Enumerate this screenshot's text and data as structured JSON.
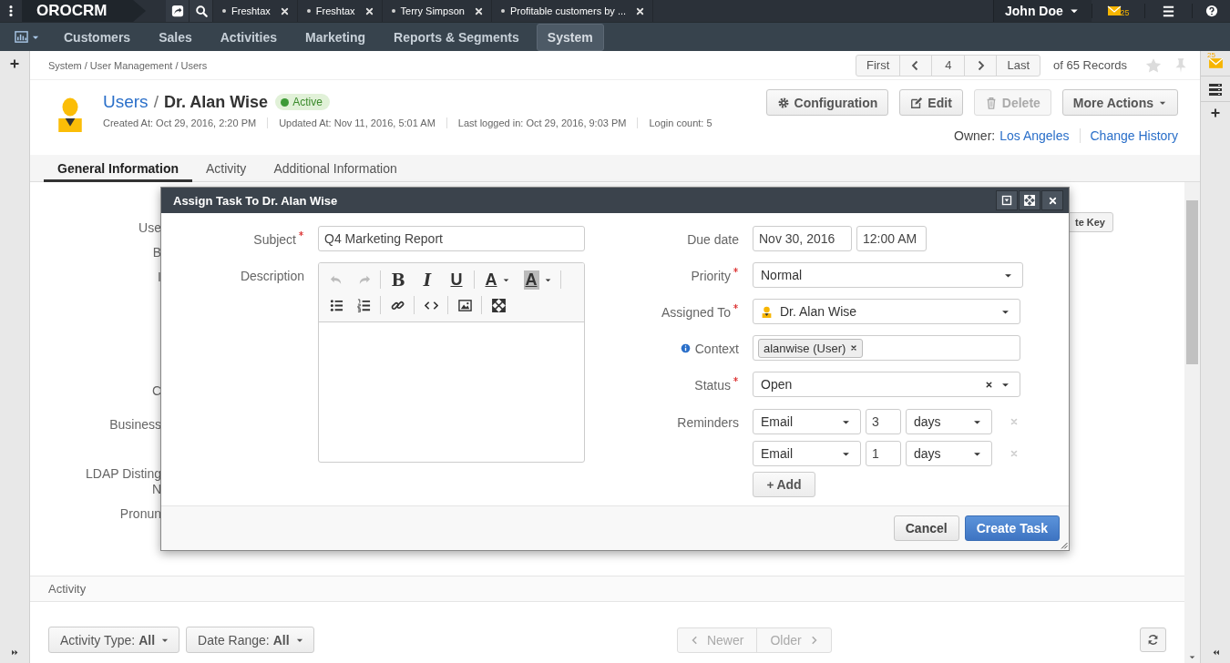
{
  "top_bar": {
    "logo": "OROCRM",
    "tabs": [
      {
        "title": "Freshtax"
      },
      {
        "title": "Freshtax"
      },
      {
        "title": "Terry Simpson"
      },
      {
        "title": "Profitable customers by ..."
      }
    ],
    "user": "John Doe",
    "mail_count": "25"
  },
  "nav": {
    "items": [
      {
        "label": "Customers",
        "selected": false
      },
      {
        "label": "Sales",
        "selected": false
      },
      {
        "label": "Activities",
        "selected": false
      },
      {
        "label": "Marketing",
        "selected": false
      },
      {
        "label": "Reports & Segments",
        "selected": false
      },
      {
        "label": "System",
        "selected": true
      }
    ]
  },
  "side_panel": {
    "mail_count": "25"
  },
  "breadcrumb": "System / User Management / Users",
  "pager": {
    "first": "First",
    "page": "4",
    "last": "Last",
    "total": "of 65 Records"
  },
  "header": {
    "section": "Users",
    "separator": "/",
    "name": "Dr. Alan Wise",
    "status": "Active",
    "meta": [
      "Created At: Oct 29, 2016, 2:20 PM",
      "Updated At: Nov 11, 2016, 5:01 AM",
      "Last logged in: Oct 29, 2016, 9:03 PM",
      "Login count: 5"
    ],
    "actions": [
      {
        "label": "Configuration",
        "kind": "configure",
        "disabled": false
      },
      {
        "label": "Edit",
        "kind": "edit",
        "disabled": false
      },
      {
        "label": "Delete",
        "kind": "delete",
        "disabled": true
      },
      {
        "label": "More Actions",
        "kind": "menu",
        "disabled": false
      }
    ],
    "owner_label": "Owner:",
    "owner": "Los Angeles",
    "history": "Change History"
  },
  "tabs": [
    {
      "label": "General Information",
      "selected": true
    },
    {
      "label": "Activity",
      "selected": false
    },
    {
      "label": "Additional Information",
      "selected": false
    }
  ],
  "form_labels": [
    "Use",
    "B",
    "I",
    "C",
    "Business",
    "LDAP Disting",
    "N",
    "Pronun"
  ],
  "key_button": "te Key",
  "dialog": {
    "title": "Assign Task To Dr. Alan Wise",
    "subject": {
      "label": "Subject",
      "required": true,
      "value": "Q4 Marketing Report"
    },
    "description": {
      "label": "Description",
      "toolbar": [
        [
          {
            "kind": "undo",
            "disabled": true
          },
          {
            "kind": "redo",
            "disabled": true
          },
          {
            "kind": "separator"
          },
          {
            "kind": "bold",
            "label": "B"
          },
          {
            "kind": "italic",
            "label": "I"
          },
          {
            "kind": "underline",
            "label": "U"
          },
          {
            "kind": "separator"
          },
          {
            "kind": "forecolor",
            "label": "A"
          },
          {
            "kind": "backcolor",
            "label": "A"
          },
          {
            "kind": "separator"
          }
        ],
        [
          {
            "kind": "bullist"
          },
          {
            "kind": "numlist"
          },
          {
            "kind": "separator"
          },
          {
            "kind": "link"
          },
          {
            "kind": "separator"
          },
          {
            "kind": "code"
          },
          {
            "kind": "separator"
          },
          {
            "kind": "image"
          },
          {
            "kind": "separator"
          },
          {
            "kind": "fullscreen"
          }
        ]
      ]
    },
    "due_date": {
      "label": "Due date",
      "date": "Nov 30, 2016",
      "time": "12:00 AM"
    },
    "priority": {
      "label": "Priority",
      "required": true,
      "value": "Normal"
    },
    "assigned_to": {
      "label": "Assigned To",
      "required": true,
      "value": "Dr. Alan Wise"
    },
    "context": {
      "label": "Context",
      "tags": [
        "alanwise (User)"
      ]
    },
    "status": {
      "label": "Status",
      "required": true,
      "value": "Open"
    },
    "reminders": {
      "label": "Reminders",
      "items": [
        {
          "method": "Email",
          "count": "3",
          "unit": "days"
        },
        {
          "method": "Email",
          "count": "1",
          "unit": "days"
        }
      ],
      "add": "Add"
    },
    "buttons": [
      {
        "label": "Cancel",
        "kind": "secondary"
      },
      {
        "label": "Create Task",
        "kind": "primary"
      }
    ]
  },
  "activity": {
    "title": "Activity",
    "filters": [
      {
        "label": "Activity Type:",
        "value": "All"
      },
      {
        "label": "Date Range:",
        "value": "All"
      }
    ],
    "newer": "Newer",
    "older": "Older"
  }
}
